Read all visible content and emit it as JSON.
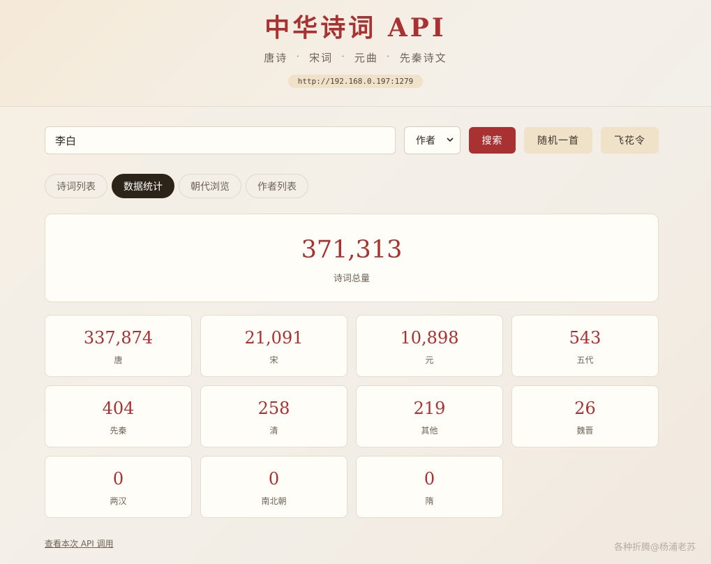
{
  "header": {
    "title": "中华诗词 API",
    "subtitle_items": [
      "唐诗",
      "宋词",
      "元曲",
      "先秦诗文"
    ],
    "separator": "·",
    "url": "http://192.168.0.197:1279"
  },
  "search": {
    "value": "李白",
    "select_value": "作者",
    "search_label": "搜索",
    "random_label": "随机一首",
    "fly_label": "飞花令"
  },
  "tabs": [
    {
      "label": "诗词列表",
      "active": false
    },
    {
      "label": "数据统计",
      "active": true
    },
    {
      "label": "朝代浏览",
      "active": false
    },
    {
      "label": "作者列表",
      "active": false
    }
  ],
  "total": {
    "value": "371,313",
    "label": "诗词总量"
  },
  "stats": [
    {
      "value": "337,874",
      "label": "唐"
    },
    {
      "value": "21,091",
      "label": "宋"
    },
    {
      "value": "10,898",
      "label": "元"
    },
    {
      "value": "543",
      "label": "五代"
    },
    {
      "value": "404",
      "label": "先秦"
    },
    {
      "value": "258",
      "label": "清"
    },
    {
      "value": "219",
      "label": "其他"
    },
    {
      "value": "26",
      "label": "魏晋"
    },
    {
      "value": "0",
      "label": "两汉"
    },
    {
      "value": "0",
      "label": "南北朝"
    },
    {
      "value": "0",
      "label": "隋"
    }
  ],
  "footer": {
    "api_link": "查看本次 API 调用",
    "watermark": "各种折腾@杨浦老苏"
  },
  "colors": {
    "accent": "#a83232",
    "beige_button": "#efe2c8",
    "active_tab": "#2d2419"
  },
  "icons": {
    "select_chevron": "chevron-down-icon"
  }
}
